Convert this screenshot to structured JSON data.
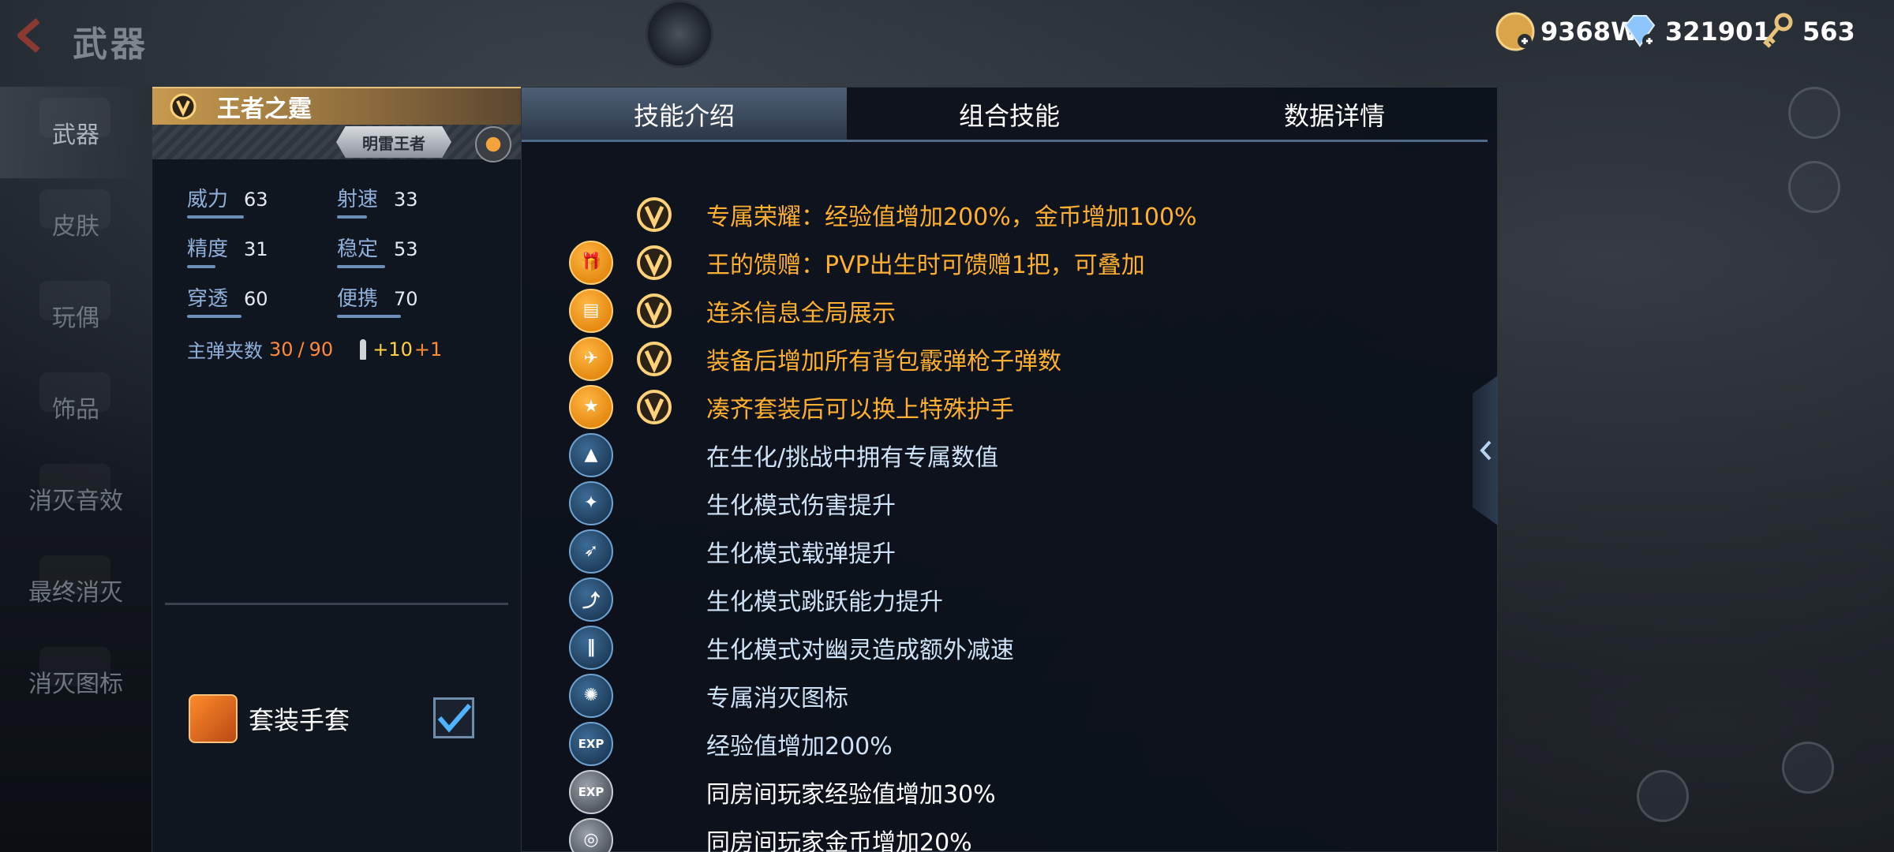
{
  "header": {
    "title": "武器",
    "currencies": [
      {
        "icon": "gold-coin-icon",
        "value": "9368W"
      },
      {
        "icon": "diamond-icon",
        "value": "321901"
      },
      {
        "icon": "key-icon",
        "value": "563"
      }
    ]
  },
  "sidebar": {
    "items": [
      {
        "label": "武器"
      },
      {
        "label": "皮肤"
      },
      {
        "label": "玩偶"
      },
      {
        "label": "饰品"
      },
      {
        "label": "消灭音效"
      },
      {
        "label": "最终消灭"
      },
      {
        "label": "消灭图标"
      }
    ]
  },
  "weapon": {
    "name": "王者之霆",
    "badge": "明雷王者",
    "stats": [
      {
        "label": "威力",
        "value": "63",
        "level": 0.63
      },
      {
        "label": "射速",
        "value": "33",
        "level": 0.33
      },
      {
        "label": "精度",
        "value": "31",
        "level": 0.31
      },
      {
        "label": "稳定",
        "value": "53",
        "level": 0.53
      },
      {
        "label": "穿透",
        "value": "60",
        "level": 0.6
      },
      {
        "label": "便携",
        "value": "70",
        "level": 0.7
      }
    ],
    "ammo": {
      "label": "主弹夹数",
      "current": "30",
      "sep": "/",
      "max": "90",
      "bonus1": "+10",
      "bonus2": "+1"
    },
    "gloves": {
      "label": "套装手套",
      "checked": true
    }
  },
  "tabs": [
    {
      "label": "技能介绍",
      "active": true
    },
    {
      "label": "组合技能",
      "active": false
    },
    {
      "label": "数据详情",
      "active": false
    }
  ],
  "skills": [
    {
      "icon": "none",
      "icon2": "v-badge-icon",
      "style": "gold",
      "text": "专属荣耀：经验值增加200%，金币增加100%"
    },
    {
      "icon": "gift-icon",
      "icon2": "v-badge-icon",
      "style": "gold",
      "text": "王的馈赠：PVP出生时可馈赠1把，可叠加"
    },
    {
      "icon": "kill-info-icon",
      "icon2": "v-badge-icon",
      "style": "gold",
      "text": "连杀信息全局展示"
    },
    {
      "icon": "shotgun-icon",
      "icon2": "v-badge-icon",
      "style": "gold",
      "text": "装备后增加所有背包霰弹枪子弹数"
    },
    {
      "icon": "star-icon",
      "icon2": "v-badge-icon",
      "style": "gold",
      "text": "凑齐套装后可以换上特殊护手"
    },
    {
      "icon": "triangle-icon",
      "icon2": "",
      "style": "blue",
      "text": "在生化/挑战中拥有专属数值"
    },
    {
      "icon": "damage-icon",
      "icon2": "",
      "style": "blue",
      "text": "生化模式伤害提升"
    },
    {
      "icon": "gun-icon",
      "icon2": "",
      "style": "blue",
      "text": "生化模式载弹提升"
    },
    {
      "icon": "jump-icon",
      "icon2": "",
      "style": "blue",
      "text": "生化模式跳跃能力提升"
    },
    {
      "icon": "bullets-icon",
      "icon2": "",
      "style": "blue",
      "text": "生化模式对幽灵造成额外减速"
    },
    {
      "icon": "kill-icon",
      "icon2": "",
      "style": "blue",
      "text": "专属消灭图标"
    },
    {
      "icon": "exp-icon",
      "icon2": "",
      "style": "blue",
      "text": "经验值增加200%"
    },
    {
      "icon": "room-exp-icon",
      "icon2": "",
      "style": "gray",
      "text": "同房间玩家经验值增加30%"
    },
    {
      "icon": "room-coin-icon",
      "icon2": "",
      "style": "gray",
      "text": "同房间玩家金币增加20%"
    }
  ],
  "colors": {
    "accent_gold": "#ffb030",
    "accent_orange": "#ff8a3b",
    "stat_label": "#8fb1d9"
  }
}
